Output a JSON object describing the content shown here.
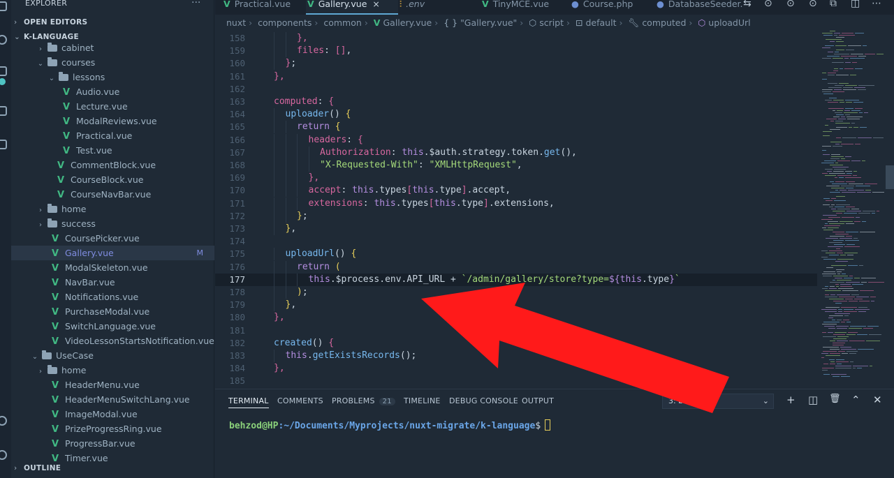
{
  "sidebar": {
    "title": "EXPLORER",
    "more_icon": "ellipsis-icon",
    "open_editors": "OPEN EDITORS",
    "project": "K-LANGUAGE",
    "outline": "OUTLINE",
    "tree": [
      {
        "label": "cabinet",
        "type": "folder",
        "indent": 1,
        "open": false
      },
      {
        "label": "courses",
        "type": "folder",
        "indent": 1,
        "open": true
      },
      {
        "label": "lessons",
        "type": "folder",
        "indent": 2,
        "open": true
      },
      {
        "label": "Audio.vue",
        "type": "vue",
        "indent": 3
      },
      {
        "label": "Lecture.vue",
        "type": "vue",
        "indent": 3
      },
      {
        "label": "ModalReviews.vue",
        "type": "vue",
        "indent": 3
      },
      {
        "label": "Practical.vue",
        "type": "vue",
        "indent": 3
      },
      {
        "label": "Test.vue",
        "type": "vue",
        "indent": 3
      },
      {
        "label": "CommentBlock.vue",
        "type": "vue",
        "indent": 2
      },
      {
        "label": "CourseBlock.vue",
        "type": "vue",
        "indent": 2
      },
      {
        "label": "CourseNavBar.vue",
        "type": "vue",
        "indent": 2
      },
      {
        "label": "home",
        "type": "folder",
        "indent": 1,
        "open": false
      },
      {
        "label": "success",
        "type": "folder",
        "indent": 1,
        "open": false
      },
      {
        "label": "CoursePicker.vue",
        "type": "vue",
        "indent": 1
      },
      {
        "label": "Gallery.vue",
        "type": "vue",
        "indent": 1,
        "selected": true,
        "badge": "M"
      },
      {
        "label": "ModalSkeleton.vue",
        "type": "vue",
        "indent": 1
      },
      {
        "label": "NavBar.vue",
        "type": "vue",
        "indent": 1
      },
      {
        "label": "Notifications.vue",
        "type": "vue",
        "indent": 1
      },
      {
        "label": "PurchaseModal.vue",
        "type": "vue",
        "indent": 1
      },
      {
        "label": "SwitchLanguage.vue",
        "type": "vue",
        "indent": 1
      },
      {
        "label": "VideoLessonStartsNotification.vue",
        "type": "vue",
        "indent": 1
      },
      {
        "label": "UseCase",
        "type": "folder",
        "indent": 0,
        "open": true
      },
      {
        "label": "home",
        "type": "folder",
        "indent": 1,
        "open": false
      },
      {
        "label": "HeaderMenu.vue",
        "type": "vue",
        "indent": 1
      },
      {
        "label": "HeaderMenuSwitchLang.vue",
        "type": "vue",
        "indent": 1
      },
      {
        "label": "ImageModal.vue",
        "type": "vue",
        "indent": 1
      },
      {
        "label": "PrizeProgressRing.vue",
        "type": "vue",
        "indent": 1
      },
      {
        "label": "ProgressBar.vue",
        "type": "vue",
        "indent": 1
      },
      {
        "label": "Timer.vue",
        "type": "vue",
        "indent": 1
      }
    ]
  },
  "tabs": [
    {
      "label": "Practical.vue",
      "kind": "vue"
    },
    {
      "label": "Gallery.vue",
      "kind": "vue",
      "active": true,
      "close": "×"
    },
    {
      "label": ".env",
      "kind": "env",
      "italic": true
    },
    {
      "label": "TinyMCE.vue",
      "kind": "vue"
    },
    {
      "label": "Course.php",
      "kind": "php"
    },
    {
      "label": "DatabaseSeeder.",
      "kind": "php"
    }
  ],
  "breadcrumb": {
    "parts": [
      "nuxt",
      "components",
      "common"
    ],
    "file": "Gallery.vue",
    "braces": "{ }",
    "component": "\"Gallery.vue\"",
    "script": "script",
    "default": "default",
    "computed": "computed",
    "method": "uploadUrl"
  },
  "editor": {
    "current_line": 177,
    "lines": [
      {
        "n": "158",
        "i": 2,
        "t": [
          [
            "p",
            "},"
          ]
        ]
      },
      {
        "n": "159",
        "i": 2,
        "t": [
          [
            "k",
            "files"
          ],
          [
            "v",
            ": "
          ],
          [
            "p",
            "[]"
          ],
          [
            "v",
            ","
          ]
        ]
      },
      {
        "n": "160",
        "i": 1,
        "t": [
          [
            "p",
            "}"
          ],
          [
            "v",
            ";"
          ]
        ]
      },
      {
        "n": "161",
        "i": 0,
        "t": [
          [
            "p",
            "},"
          ]
        ]
      },
      {
        "n": "162",
        "i": 0,
        "t": []
      },
      {
        "n": "163",
        "i": 0,
        "t": [
          [
            "k",
            "computed"
          ],
          [
            "v",
            ": "
          ],
          [
            "p",
            "{"
          ]
        ]
      },
      {
        "n": "164",
        "i": 1,
        "t": [
          [
            "f",
            "uploader"
          ],
          [
            "v",
            "() "
          ],
          [
            "y",
            "{"
          ]
        ]
      },
      {
        "n": "165",
        "i": 2,
        "t": [
          [
            "pu",
            "return "
          ],
          [
            "y",
            "{"
          ]
        ]
      },
      {
        "n": "166",
        "i": 3,
        "t": [
          [
            "k",
            "headers"
          ],
          [
            "v",
            ": "
          ],
          [
            "p",
            "{"
          ]
        ]
      },
      {
        "n": "167",
        "i": 4,
        "t": [
          [
            "k",
            "Authorization"
          ],
          [
            "v",
            ": "
          ],
          [
            "pu",
            "this"
          ],
          [
            "v",
            ".$auth.strategy.token."
          ],
          [
            "f",
            "get"
          ],
          [
            "v",
            "(),"
          ]
        ]
      },
      {
        "n": "168",
        "i": 4,
        "t": [
          [
            "s",
            "\"X-Requested-With\""
          ],
          [
            "v",
            ": "
          ],
          [
            "s",
            "\"XMLHttpRequest\""
          ],
          [
            "v",
            ","
          ]
        ]
      },
      {
        "n": "169",
        "i": 3,
        "t": [
          [
            "p",
            "},"
          ]
        ]
      },
      {
        "n": "170",
        "i": 3,
        "t": [
          [
            "k",
            "accept"
          ],
          [
            "v",
            ": "
          ],
          [
            "pu",
            "this"
          ],
          [
            "v",
            ".types"
          ],
          [
            "p",
            "["
          ],
          [
            "pu",
            "this"
          ],
          [
            "v",
            ".type"
          ],
          [
            "p",
            "]"
          ],
          [
            "v",
            ".accept,"
          ]
        ]
      },
      {
        "n": "171",
        "i": 3,
        "t": [
          [
            "k",
            "extensions"
          ],
          [
            "v",
            ": "
          ],
          [
            "pu",
            "this"
          ],
          [
            "v",
            ".types"
          ],
          [
            "p",
            "["
          ],
          [
            "pu",
            "this"
          ],
          [
            "v",
            ".type"
          ],
          [
            "p",
            "]"
          ],
          [
            "v",
            ".extensions,"
          ]
        ]
      },
      {
        "n": "172",
        "i": 2,
        "t": [
          [
            "y",
            "}"
          ],
          [
            "v",
            ";"
          ]
        ]
      },
      {
        "n": "173",
        "i": 1,
        "t": [
          [
            "y",
            "}"
          ],
          [
            "v",
            ","
          ]
        ]
      },
      {
        "n": "174",
        "i": 0,
        "t": []
      },
      {
        "n": "175",
        "i": 1,
        "t": [
          [
            "f",
            "uploadUrl"
          ],
          [
            "v",
            "() "
          ],
          [
            "y",
            "{"
          ]
        ]
      },
      {
        "n": "176",
        "i": 2,
        "t": [
          [
            "pu",
            "return "
          ],
          [
            "y",
            "("
          ]
        ]
      },
      {
        "n": "177",
        "i": 3,
        "t": [
          [
            "pu",
            "this"
          ],
          [
            "v",
            ".$process.env.API_URL + "
          ],
          [
            "s",
            "`/admin/gallery/store?type="
          ],
          [
            "pu",
            "${"
          ],
          [
            "pu",
            "this"
          ],
          [
            "v",
            ".type"
          ],
          [
            "pu",
            "}"
          ],
          [
            "s",
            "`"
          ]
        ]
      },
      {
        "n": "178",
        "i": 2,
        "t": [
          [
            "y",
            ")"
          ],
          [
            "v",
            ";"
          ]
        ]
      },
      {
        "n": "179",
        "i": 1,
        "t": [
          [
            "y",
            "}"
          ],
          [
            "v",
            ","
          ]
        ]
      },
      {
        "n": "180",
        "i": 0,
        "t": [
          [
            "p",
            "},"
          ]
        ]
      },
      {
        "n": "181",
        "i": 0,
        "t": []
      },
      {
        "n": "182",
        "i": 0,
        "t": [
          [
            "f",
            "created"
          ],
          [
            "v",
            "() "
          ],
          [
            "p",
            "{"
          ]
        ]
      },
      {
        "n": "183",
        "i": 1,
        "t": [
          [
            "pu",
            "this"
          ],
          [
            "v",
            "."
          ],
          [
            "f",
            "getExistsRecords"
          ],
          [
            "v",
            "();"
          ]
        ]
      },
      {
        "n": "184",
        "i": 0,
        "t": [
          [
            "p",
            "},"
          ]
        ]
      },
      {
        "n": "185",
        "i": 0,
        "t": []
      }
    ]
  },
  "panel": {
    "tabs": [
      {
        "label": "TERMINAL",
        "active": true
      },
      {
        "label": "COMMENTS"
      },
      {
        "label": "PROBLEMS",
        "count": "21"
      },
      {
        "label": "TIMELINE"
      },
      {
        "label": "DEBUG CONSOLE"
      },
      {
        "label": "OUTPUT"
      }
    ],
    "terminal_select": "3: b",
    "actions": [
      "+",
      "◫",
      "🗑",
      "⌃",
      "✕"
    ],
    "prompt_user": "behzod@HP",
    "prompt_path": ":~/Documents/Myprojects/nuxt-migrate/k-language",
    "prompt_symbol": "$"
  },
  "annotation": {
    "color": "#ff1a1a"
  }
}
